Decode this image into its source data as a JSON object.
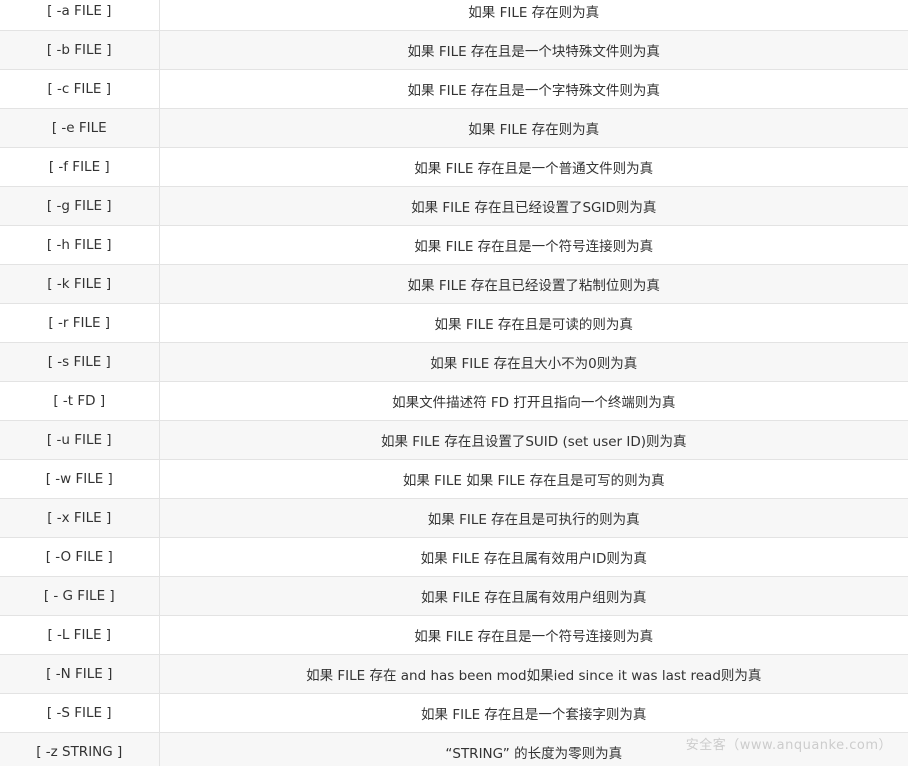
{
  "rows": [
    {
      "op": "[ -a FILE ]",
      "desc": "如果 FILE 存在则为真"
    },
    {
      "op": "[ -b FILE ]",
      "desc": "如果 FILE 存在且是一个块特殊文件则为真"
    },
    {
      "op": "[ -c FILE ]",
      "desc": "如果 FILE 存在且是一个字特殊文件则为真"
    },
    {
      "op": "[ -e FILE",
      "desc": "如果 FILE 存在则为真"
    },
    {
      "op": "[ -f FILE ]",
      "desc": "如果 FILE 存在且是一个普通文件则为真"
    },
    {
      "op": "[ -g FILE ]",
      "desc": "如果 FILE 存在且已经设置了SGID则为真"
    },
    {
      "op": "[ -h FILE ]",
      "desc": "如果 FILE 存在且是一个符号连接则为真"
    },
    {
      "op": "[ -k FILE ]",
      "desc": "如果 FILE 存在且已经设置了粘制位则为真"
    },
    {
      "op": "[ -r FILE ]",
      "desc": "如果 FILE 存在且是可读的则为真"
    },
    {
      "op": "[ -s FILE ]",
      "desc": "如果 FILE 存在且大小不为0则为真"
    },
    {
      "op": "[ -t FD ]",
      "desc": "如果文件描述符 FD 打开且指向一个终端则为真"
    },
    {
      "op": "[ -u FILE ]",
      "desc": "如果 FILE 存在且设置了SUID (set user ID)则为真"
    },
    {
      "op": "[ -w FILE ]",
      "desc": "如果 FILE 如果 FILE 存在且是可写的则为真"
    },
    {
      "op": "[ -x FILE ]",
      "desc": "如果 FILE 存在且是可执行的则为真"
    },
    {
      "op": "[ -O FILE ]",
      "desc": "如果 FILE 存在且属有效用户ID则为真"
    },
    {
      "op": "[ - G FILE ]",
      "desc": "如果 FILE 存在且属有效用户组则为真"
    },
    {
      "op": "[ -L FILE ]",
      "desc": "如果 FILE 存在且是一个符号连接则为真"
    },
    {
      "op": "[ -N FILE ]",
      "desc": "如果 FILE 存在 and has been mod如果ied since it was last read则为真"
    },
    {
      "op": "[ -S FILE ]",
      "desc": "如果 FILE 存在且是一个套接字则为真"
    },
    {
      "op": "[ -z STRING ]",
      "desc": "“STRING” 的长度为零则为真"
    }
  ],
  "watermark": "安全客（www.anquanke.com）"
}
